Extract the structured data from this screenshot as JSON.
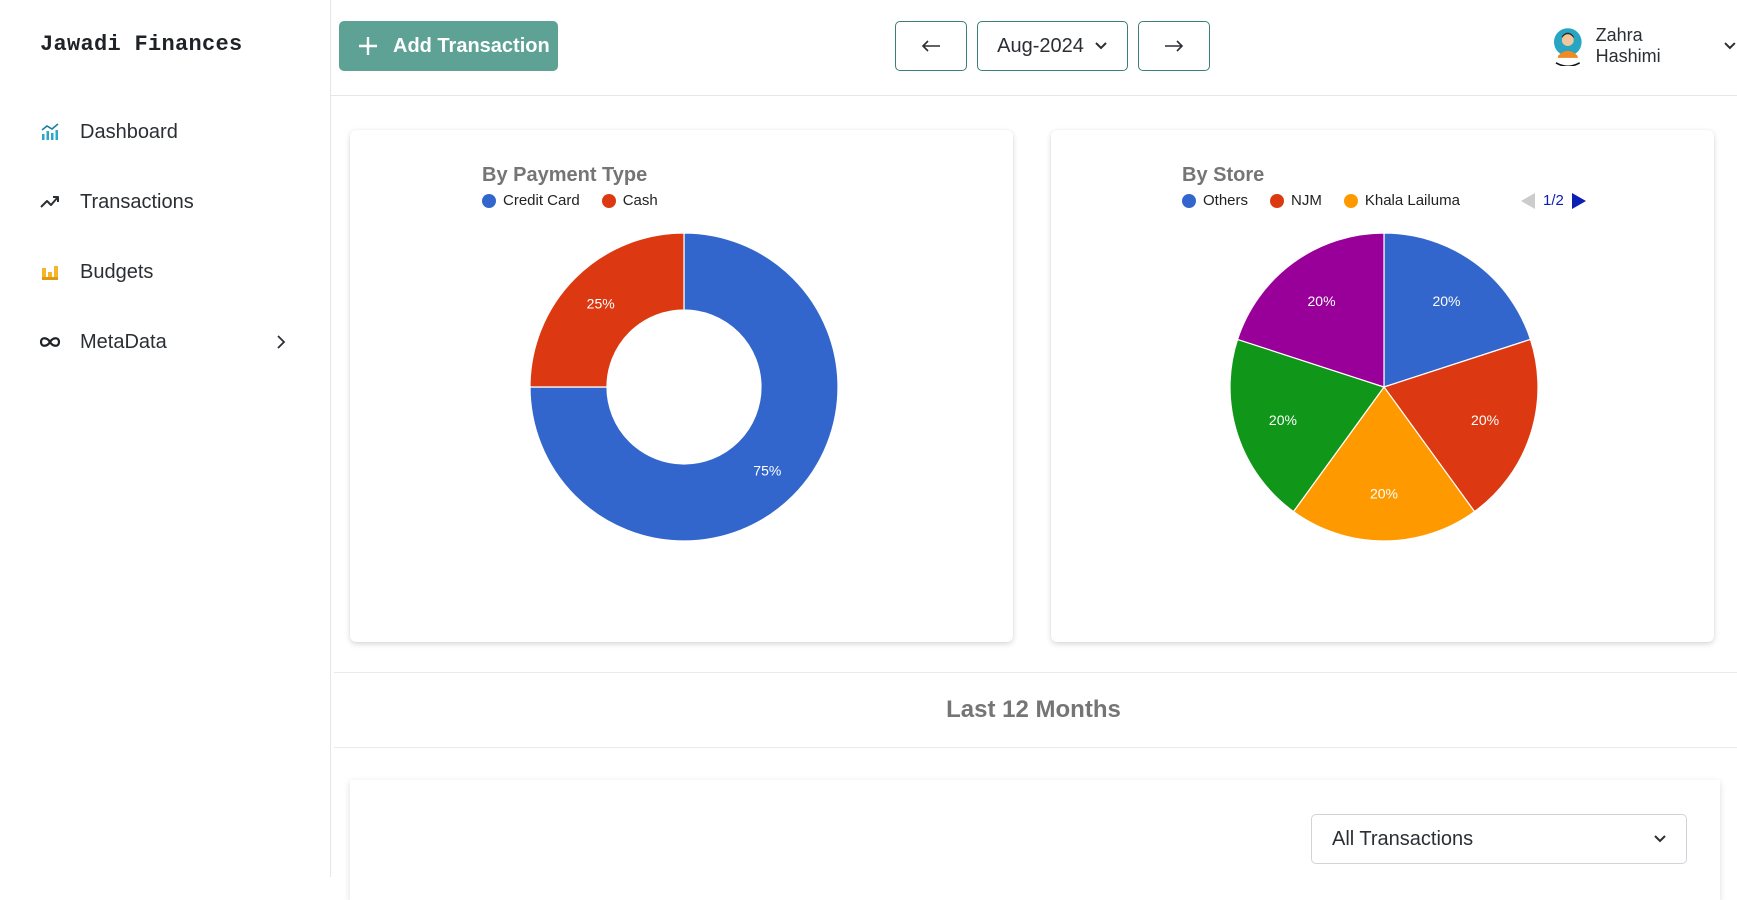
{
  "sidebar": {
    "brand": "Jawadi Finances",
    "items": [
      {
        "label": "Dashboard",
        "icon": "chart-bar-line-icon"
      },
      {
        "label": "Transactions",
        "icon": "trend-up-icon"
      },
      {
        "label": "Budgets",
        "icon": "budget-bars-icon"
      },
      {
        "label": "MetaData",
        "icon": "infinity-icon",
        "has_submenu": true
      }
    ]
  },
  "header": {
    "add_button_label": "Add Transaction",
    "selected_month": "Aug-2024",
    "user_name": "Zahra Hashimi"
  },
  "colors": {
    "accent": "#5da295",
    "blue": "#3366cc",
    "red": "#dc3912",
    "orange": "#ff9900",
    "green": "#109618",
    "purple": "#990099"
  },
  "chart_data": [
    {
      "type": "pie",
      "donut": true,
      "title": "By Payment Type",
      "series": [
        {
          "name": "Credit Card",
          "value": 75,
          "label": "75%",
          "color": "#3366cc"
        },
        {
          "name": "Cash",
          "value": 25,
          "label": "25%",
          "color": "#dc3912"
        }
      ]
    },
    {
      "type": "pie",
      "donut": false,
      "title": "By Store",
      "legend_page": "1/2",
      "legend": [
        "Others",
        "NJM",
        "Khala Lailuma"
      ],
      "series": [
        {
          "name": "Others",
          "value": 20,
          "label": "20%",
          "color": "#3366cc"
        },
        {
          "name": "NJM",
          "value": 20,
          "label": "20%",
          "color": "#dc3912"
        },
        {
          "name": "Khala Lailuma",
          "value": 20,
          "label": "20%",
          "color": "#ff9900"
        },
        {
          "name": "",
          "value": 20,
          "label": "20%",
          "color": "#109618"
        },
        {
          "name": "",
          "value": 20,
          "label": "20%",
          "color": "#990099"
        }
      ]
    }
  ],
  "section": {
    "title": "Last 12 Months"
  },
  "filter": {
    "selected": "All Transactions"
  }
}
